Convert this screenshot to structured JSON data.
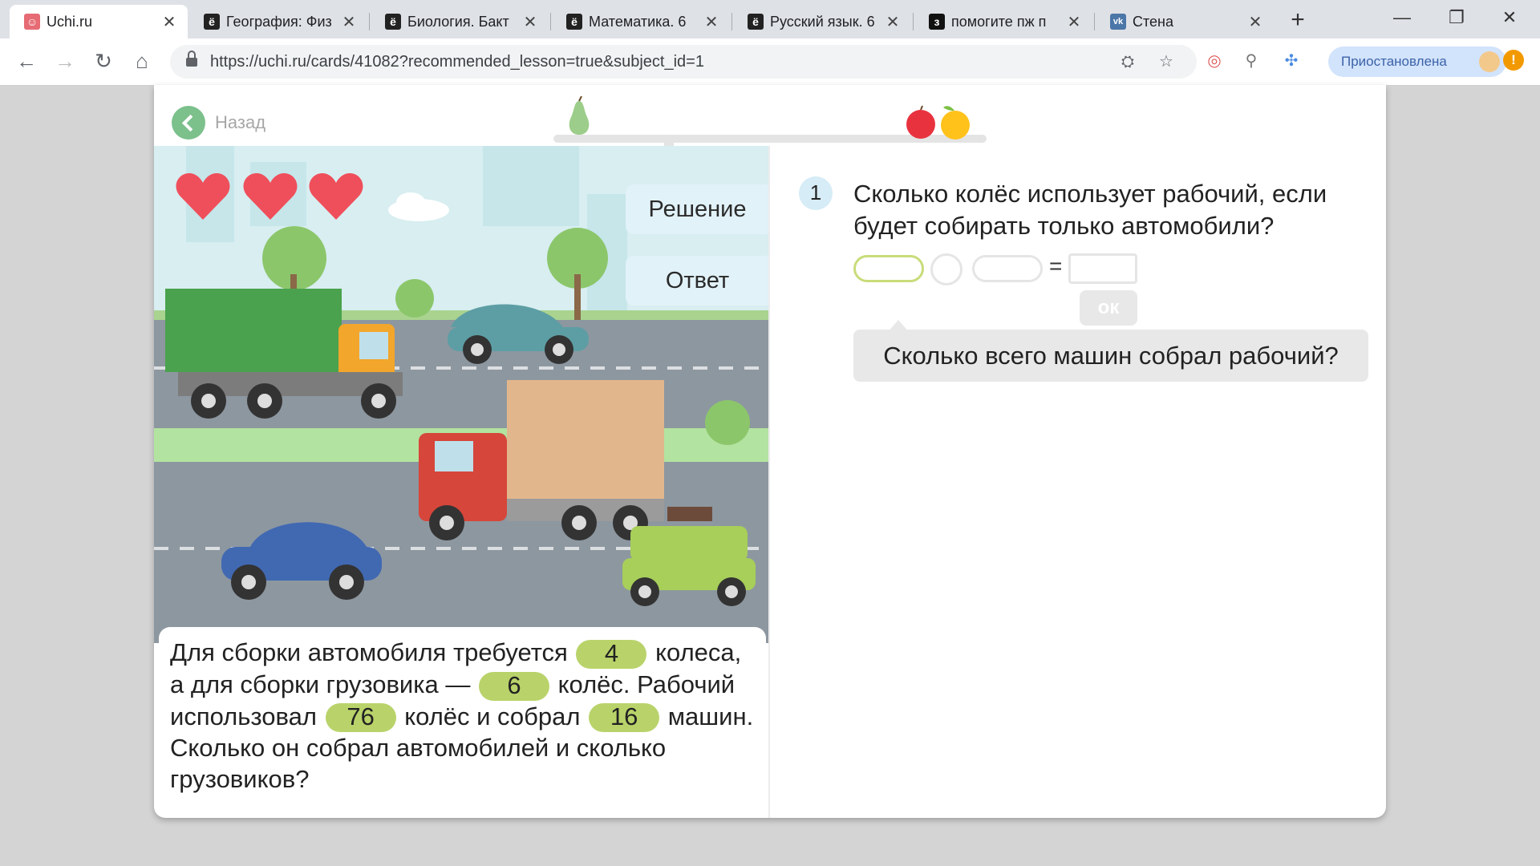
{
  "browser": {
    "tabs": [
      {
        "title": "Uchi.ru",
        "favicon": "uchi-favicon",
        "active": true
      },
      {
        "title": "География: Физ",
        "favicon": "yo-icon",
        "active": false
      },
      {
        "title": "Биология. Бакт",
        "favicon": "yo-icon",
        "active": false
      },
      {
        "title": "Математика. 6",
        "favicon": "yo-icon",
        "active": false
      },
      {
        "title": "Русский язык. 6",
        "favicon": "yo-icon",
        "active": false
      },
      {
        "title": "помогите пж п",
        "favicon": "znanija-icon",
        "active": false
      },
      {
        "title": "Стена",
        "favicon": "vk-icon",
        "active": false
      }
    ],
    "tab_close_glyph": "✕",
    "new_tab_glyph": "+",
    "window_controls": {
      "minimize": "—",
      "restore": "❐",
      "close": "✕"
    },
    "url": "https://uchi.ru/cards/41082?recommended_lesson=true&subject_id=1",
    "profile_label": "Приостановлена",
    "alert_glyph": "!"
  },
  "page": {
    "back_label": "Назад",
    "buttons": {
      "solution": "Решение",
      "answer": "Ответ"
    },
    "lives": 3,
    "problem": {
      "p1": "Для сборки автомобиля требуется",
      "v1": "4",
      "p2": "колеса, а для сборки грузовика —",
      "v2": "6",
      "p3": "колёс. Рабочий использовал",
      "v3": "76",
      "p4": "колёс и собрал",
      "v4": "16",
      "p5": "машин. Сколько он собрал автомобилей и сколько грузовиков?"
    },
    "question_number": "1",
    "question_text": "Сколько колёс использует рабочий, если будет собирать только автомобили?",
    "equals_sign": "=",
    "ok_label": "ок",
    "hint": "Сколько всего машин собрал рабочий?",
    "colors": {
      "accent_green": "#b9d36a",
      "back_green": "#7cc08c",
      "number_bubble": "#d6ecf6",
      "heart_red": "#ef4f5b"
    }
  }
}
